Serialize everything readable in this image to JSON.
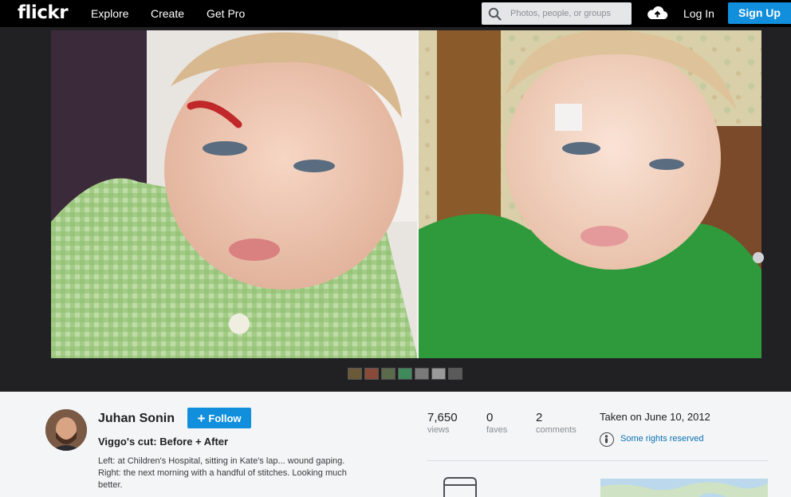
{
  "nav": {
    "logo": "flickr",
    "links": [
      "Explore",
      "Create",
      "Get Pro"
    ],
    "search_placeholder": "Photos, people, or groups",
    "login": "Log In",
    "signup": "Sign Up"
  },
  "photo": {
    "thumbnail_count": 7
  },
  "owner": {
    "name": "Juhan Sonin",
    "follow_label": "Follow"
  },
  "photo_info": {
    "title": "Viggo's cut: Before + After",
    "description": "Left: at Children's Hospital, sitting in Kate's lap... wound gaping. Right: the next morning with a handful of stitches. Looking much better."
  },
  "stats": [
    {
      "value": "7,650",
      "label": "views"
    },
    {
      "value": "0",
      "label": "faves"
    },
    {
      "value": "2",
      "label": "comments"
    }
  ],
  "meta": {
    "taken": "Taken on June 10, 2012",
    "license": "Some rights reserved"
  },
  "colors": {
    "brand_blue": "#128fdc",
    "nav_bg": "#000000",
    "stage_bg": "#212124",
    "page_bg": "#f3f5f6"
  }
}
